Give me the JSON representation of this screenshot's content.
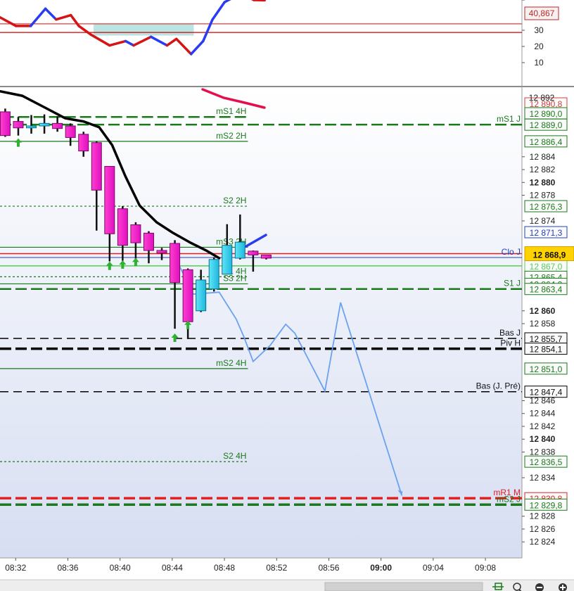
{
  "chart_data": [
    {
      "type": "line",
      "id": "oscillator",
      "y_ticks": [
        "30",
        "20",
        "10"
      ],
      "ylim": [
        0,
        50
      ],
      "thresholds": [
        {
          "value": 30,
          "color": "#e23b3b"
        },
        {
          "value": 26,
          "color": "#d40000"
        }
      ],
      "current_label": "40,867",
      "series": {
        "x": [
          0,
          1.2,
          2.3,
          3.4,
          4.2,
          5.3,
          5.9,
          6.8,
          8.2,
          9.4,
          10.0,
          11.3,
          12.5,
          13.2,
          14.3,
          15.2,
          15.9,
          16.8,
          18.0,
          19.0,
          19.8
        ],
        "y": [
          33,
          29,
          29,
          37,
          32,
          34,
          29,
          25,
          20,
          22,
          20,
          24,
          20,
          23,
          16,
          22,
          32,
          40,
          44,
          41,
          40.9
        ],
        "colors": [
          "red",
          "red",
          "blue",
          "blue",
          "red",
          "red",
          "red",
          "red",
          "red",
          "blue",
          "red",
          "blue",
          "red",
          "red",
          "blue",
          "blue",
          "blue",
          "blue",
          "red",
          "red"
        ]
      },
      "fill_band": {
        "x": [
          7.0,
          14.5
        ],
        "low": 20,
        "high": 30,
        "color": "#a9dede"
      }
    },
    {
      "type": "candlestick",
      "id": "price",
      "x_ticks": [
        {
          "m": 32,
          "label": "08:32",
          "bold": false
        },
        {
          "m": 36,
          "label": "08:36",
          "bold": false
        },
        {
          "m": 40,
          "label": "08:40",
          "bold": false
        },
        {
          "m": 44,
          "label": "08:44",
          "bold": false
        },
        {
          "m": 48,
          "label": "08:48",
          "bold": false
        },
        {
          "m": 52,
          "label": "08:52",
          "bold": false
        },
        {
          "m": 56,
          "label": "08:56",
          "bold": false
        },
        {
          "m": 60,
          "label": "09:00",
          "bold": true
        },
        {
          "m": 64,
          "label": "09:04",
          "bold": false
        },
        {
          "m": 68,
          "label": "09:08",
          "bold": false
        }
      ],
      "y_ticks": [
        {
          "v": 12884,
          "label": "12 884",
          "bold": false
        },
        {
          "v": 12882,
          "label": "12 882",
          "bold": false
        },
        {
          "v": 12880,
          "label": "12 880",
          "bold": true
        },
        {
          "v": 12878,
          "label": "12 878",
          "bold": false
        },
        {
          "v": 12874,
          "label": "12 874",
          "bold": false
        },
        {
          "v": 12860,
          "label": "12 860",
          "bold": true
        },
        {
          "v": 12858,
          "label": "12 858",
          "bold": false
        },
        {
          "v": 12846,
          "label": "12 846",
          "bold": false
        },
        {
          "v": 12844,
          "label": "12 844",
          "bold": false
        },
        {
          "v": 12842,
          "label": "12 842",
          "bold": false
        },
        {
          "v": 12840,
          "label": "12 840",
          "bold": true
        },
        {
          "v": 12838,
          "label": "12 838",
          "bold": false
        },
        {
          "v": 12834,
          "label": "12 834",
          "bold": false
        },
        {
          "v": 12828,
          "label": "12 828",
          "bold": false
        },
        {
          "v": 12826,
          "label": "12 826",
          "bold": false
        },
        {
          "v": 12824,
          "label": "12 824",
          "bold": false
        }
      ],
      "ylim": [
        12821.5,
        12894.5
      ],
      "xlim": [
        30.8,
        70.8
      ],
      "levels": [
        {
          "v": 12890.2,
          "name": "mS1 4H",
          "color": "#1a7a1a",
          "style": "dash",
          "w": 2.5,
          "x0": 31,
          "x1": 49.8
        },
        {
          "v": 12889.0,
          "name": "mS1 J",
          "color": "#1a7a1a",
          "style": "dash",
          "w": 2.5,
          "x0": 30.8,
          "x1": 70.8,
          "tag": "12 889,0"
        },
        {
          "v": 12886.4,
          "name": "mS2 2H",
          "color": "#1a7a1a",
          "style": "solid",
          "w": 1.2,
          "x0": 30.8,
          "x1": 49.8,
          "tag": "12 886,4"
        },
        {
          "v": 12876.3,
          "name": "S2 2H",
          "color": "#1a7a1a",
          "style": "dot",
          "w": 1.2,
          "x0": 30.8,
          "x1": 49.8,
          "tag": "12 876,3"
        },
        {
          "v": 12869.9,
          "name": "mS3 2H",
          "color": "#1a7a1a",
          "style": "solid",
          "w": 1.2,
          "x0": 30.8,
          "x1": 49.8
        },
        {
          "v": 12868.9,
          "name": "",
          "color": "#e02020",
          "style": "solid",
          "w": 1.5,
          "x0": 30.8,
          "x1": 70.8
        },
        {
          "v": 12868.3,
          "name": "Clo J",
          "color": "#2040c0",
          "style": "solid",
          "w": 1,
          "x0": 30.8,
          "x1": 70.8
        },
        {
          "v": 12867.0,
          "name": "",
          "color": "#50d050",
          "style": "solid",
          "w": 1.5,
          "x0": 30.8,
          "x1": 70.8,
          "tag": "12 867,0"
        },
        {
          "v": 12865.3,
          "name": "S1 4H",
          "color": "#1a7a1a",
          "style": "dot",
          "w": 1.2,
          "x0": 30.8,
          "x1": 49.8,
          "tag": "12 865,4"
        },
        {
          "v": 12864.2,
          "name": "S3 2H",
          "color": "#1a7a1a",
          "style": "solid",
          "w": 1.2,
          "x0": 30.8,
          "x1": 49.8,
          "tag": "12 864,2"
        },
        {
          "v": 12863.4,
          "name": "S1 J",
          "color": "#1a7a1a",
          "style": "dash",
          "w": 2.5,
          "x0": 30.8,
          "x1": 70.8,
          "tag": "12 863,4"
        },
        {
          "v": 12855.7,
          "name": "Bas J",
          "color": "#000000",
          "style": "dash",
          "w": 1.5,
          "x0": 30.8,
          "x1": 70.8,
          "tag": "12 855,7"
        },
        {
          "v": 12854.1,
          "name": "Piv H",
          "color": "#000000",
          "style": "dash",
          "w": 3.5,
          "x0": 30.8,
          "x1": 70.8,
          "tag": "12 854,1"
        },
        {
          "v": 12851.0,
          "name": "mS2 4H",
          "color": "#1a7a1a",
          "style": "solid",
          "w": 1.2,
          "x0": 30.8,
          "x1": 49.8,
          "tag": "12 851,0"
        },
        {
          "v": 12847.4,
          "name": "Bas (J. Pré)",
          "color": "#000000",
          "style": "dash",
          "w": 1.5,
          "x0": 30.8,
          "x1": 70.8,
          "tag": "12 847,4"
        },
        {
          "v": 12836.5,
          "name": "S2 4H",
          "color": "#1a7a1a",
          "style": "dot",
          "w": 1.2,
          "x0": 30.8,
          "x1": 49.8,
          "tag": "12 836,5"
        },
        {
          "v": 12830.8,
          "name": "mR1 M",
          "color": "#e02020",
          "style": "dash",
          "w": 3.5,
          "x0": 30.8,
          "x1": 70.8,
          "tag": "12 830,8"
        },
        {
          "v": 12829.8,
          "name": "mS2 J",
          "color": "#1a7a1a",
          "style": "dash",
          "w": 3.5,
          "x0": 30.8,
          "x1": 70.8,
          "tag": "12 829,8"
        }
      ],
      "top_tag": "12 890,8",
      "mid_tag": "12 890,0",
      "top_faint": "12 892",
      "partial_tags": [
        {
          "v": 12888.2,
          "label": "12 871,3"
        }
      ],
      "price_tag": "12 868,9",
      "faint_axis": [
        "12 866",
        "12 848",
        "12 832"
      ],
      "candles": [
        {
          "m": 31.2,
          "o": 12891,
          "h": 12891.5,
          "l": 12887.1,
          "c": 12887.3
        },
        {
          "m": 32.2,
          "o": 12889.5,
          "h": 12890.2,
          "l": 12887.3,
          "c": 12888.5
        },
        {
          "m": 33.2,
          "o": 12888.5,
          "h": 12890.5,
          "l": 12887.6,
          "c": 12888.8
        },
        {
          "m": 34.2,
          "o": 12888.8,
          "h": 12890.6,
          "l": 12887.6,
          "c": 12889.2
        },
        {
          "m": 35.2,
          "o": 12889.2,
          "h": 12890.3,
          "l": 12887.9,
          "c": 12888.4
        },
        {
          "m": 36.2,
          "o": 12888.8,
          "h": 12889.2,
          "l": 12885.7,
          "c": 12887.0
        },
        {
          "m": 37.2,
          "o": 12887.5,
          "h": 12887.9,
          "l": 12884.0,
          "c": 12884.9
        },
        {
          "m": 38.2,
          "o": 12886.2,
          "h": 12886.4,
          "l": 12872.5,
          "c": 12878.8
        },
        {
          "m": 39.2,
          "o": 12882.5,
          "h": 12882.5,
          "l": 12867.7,
          "c": 12872.0
        },
        {
          "m": 40.2,
          "o": 12875.9,
          "h": 12876.3,
          "l": 12867.8,
          "c": 12870.2
        },
        {
          "m": 41.2,
          "o": 12873.4,
          "h": 12873.8,
          "l": 12867.9,
          "c": 12870.6
        },
        {
          "m": 42.2,
          "o": 12872.1,
          "h": 12872.4,
          "l": 12867.4,
          "c": 12869.4
        },
        {
          "m": 43.2,
          "o": 12869.4,
          "h": 12869.8,
          "l": 12867.9,
          "c": 12869.0
        },
        {
          "m": 44.2,
          "o": 12870.5,
          "h": 12871.0,
          "l": 12857.2,
          "c": 12864.4
        },
        {
          "m": 45.2,
          "o": 12866.4,
          "h": 12866.6,
          "l": 12855.6,
          "c": 12858.3
        },
        {
          "m": 46.2,
          "o": 12860.0,
          "h": 12866.4,
          "l": 12859.8,
          "c": 12864.8
        },
        {
          "m": 47.2,
          "o": 12863.4,
          "h": 12868.3,
          "l": 12863.0,
          "c": 12868.0
        },
        {
          "m": 48.2,
          "o": 12865.7,
          "h": 12873.5,
          "l": 12865.7,
          "c": 12870.2
        },
        {
          "m": 49.2,
          "o": 12868.2,
          "h": 12875.0,
          "l": 12868.0,
          "c": 12870.7
        },
        {
          "m": 50.2,
          "o": 12869.3,
          "h": 12869.4,
          "l": 12866.1,
          "c": 12868.7
        },
        {
          "m": 51.2,
          "o": 12868.7,
          "h": 12868.7,
          "l": 12868.0,
          "c": 12868.2
        }
      ],
      "ma": {
        "x": [
          30.8,
          32.5,
          34.2,
          35.8,
          37.2,
          38.4,
          39.4,
          40.4,
          41.5,
          42.8,
          44.0,
          45.4,
          46.6,
          47.6
        ],
        "y": [
          12894.2,
          12893.5,
          12891.7,
          12890.0,
          12889.5,
          12888.6,
          12885.8,
          12881.0,
          12876.4,
          12873.8,
          12872.2,
          12870.6,
          12869.4,
          12868.2
        ]
      },
      "projection": {
        "x": [
          44.4,
          45.6,
          47.6,
          48.9,
          49.5,
          50.2,
          51.5,
          52.7,
          53.4,
          55.7,
          56.9,
          61.6
        ],
        "y": [
          12867.6,
          12862.6,
          12862.9,
          12858.7,
          12855.9,
          12852.1,
          12854.6,
          12857.9,
          12856.5,
          12847.5,
          12861.3,
          12831.2
        ]
      }
    }
  ]
}
